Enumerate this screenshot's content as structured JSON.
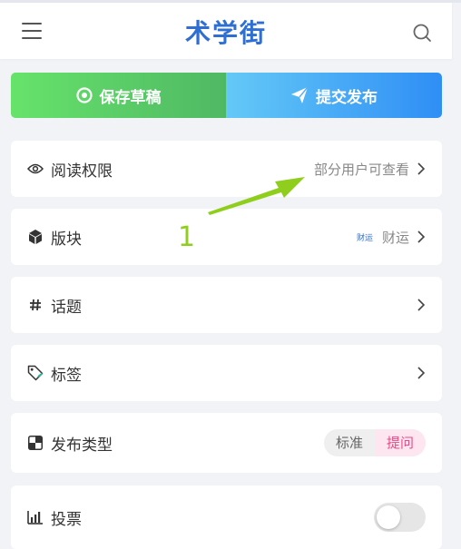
{
  "header": {
    "title": "术学街",
    "menu_icon": "hamburger-menu-icon",
    "search_icon": "search-icon",
    "title_color": "#2f6fd3"
  },
  "actions": {
    "save_label": "保存草稿",
    "submit_label": "提交发布",
    "save_color": "#5fd366",
    "submit_color": "#2f8ef5"
  },
  "settings": {
    "read_permission": {
      "label": "阅读权限",
      "value": "部分用户可查看",
      "icon": "eye-icon"
    },
    "section": {
      "label": "版块",
      "tag": "财运",
      "value": "财运",
      "icon": "cube-icon"
    },
    "topic": {
      "label": "话题",
      "icon": "hashtag-icon"
    },
    "tags": {
      "label": "标签",
      "icon": "tag-icon"
    },
    "publish_type": {
      "label": "发布类型",
      "options": [
        "标准",
        "提问"
      ],
      "selected": "提问",
      "icon": "quadrant-icon"
    },
    "vote": {
      "label": "投票",
      "enabled": false,
      "icon": "bar-chart-icon"
    }
  },
  "annotation": {
    "number": "1",
    "color": "#8fce1c"
  }
}
